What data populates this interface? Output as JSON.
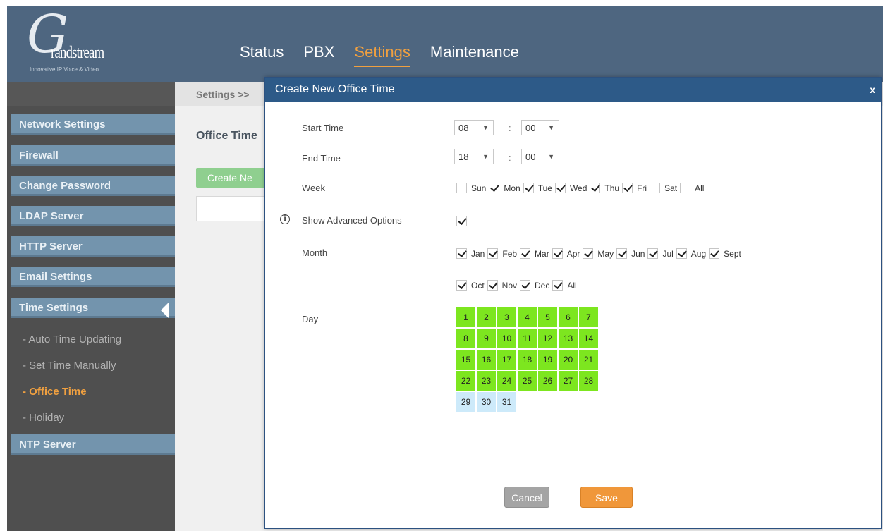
{
  "logo": {
    "word": "randstream",
    "tagline": "Innovative IP Voice & Video"
  },
  "top_nav": [
    {
      "label": "Status",
      "active": false
    },
    {
      "label": "PBX",
      "active": false
    },
    {
      "label": "Settings",
      "active": true
    },
    {
      "label": "Maintenance",
      "active": false
    }
  ],
  "sidebar": {
    "items": [
      {
        "label": "Network Settings"
      },
      {
        "label": "Firewall"
      },
      {
        "label": "Change Password"
      },
      {
        "label": "LDAP Server"
      },
      {
        "label": "HTTP Server"
      },
      {
        "label": "Email Settings"
      },
      {
        "label": "Time Settings"
      },
      {
        "label": "NTP Server"
      }
    ],
    "sub_items": [
      {
        "label": "- Auto Time Updating",
        "active": false
      },
      {
        "label": "- Set Time Manually",
        "active": false
      },
      {
        "label": "- Office Time",
        "active": true
      },
      {
        "label": "- Holiday",
        "active": false
      }
    ]
  },
  "main": {
    "breadcrumb": "Settings >>",
    "page_title": "Office Time",
    "create_button": "Create Ne"
  },
  "modal": {
    "title": "Create New Office Time",
    "close": "x",
    "start_time": {
      "label": "Start Time",
      "hour": "08",
      "minute": "00",
      "sep": ":"
    },
    "end_time": {
      "label": "End Time",
      "hour": "18",
      "minute": "00",
      "sep": ":"
    },
    "week": {
      "label": "Week",
      "days": [
        {
          "label": "Sun",
          "checked": false
        },
        {
          "label": "Mon",
          "checked": true
        },
        {
          "label": "Tue",
          "checked": true
        },
        {
          "label": "Wed",
          "checked": true
        },
        {
          "label": "Thu",
          "checked": true
        },
        {
          "label": "Fri",
          "checked": true
        },
        {
          "label": "Sat",
          "checked": false
        },
        {
          "label": "All",
          "checked": false
        }
      ]
    },
    "advanced": {
      "label": "Show Advanced Options",
      "checked": true
    },
    "month": {
      "label": "Month",
      "row1": [
        {
          "label": "Jan",
          "checked": true
        },
        {
          "label": "Feb",
          "checked": true
        },
        {
          "label": "Mar",
          "checked": true
        },
        {
          "label": "Apr",
          "checked": true
        },
        {
          "label": "May",
          "checked": true
        },
        {
          "label": "Jun",
          "checked": true
        },
        {
          "label": "Jul",
          "checked": true
        },
        {
          "label": "Aug",
          "checked": true
        },
        {
          "label": "Sept",
          "checked": true
        }
      ],
      "row2": [
        {
          "label": "Oct",
          "checked": true
        },
        {
          "label": "Nov",
          "checked": true
        },
        {
          "label": "Dec",
          "checked": true
        },
        {
          "label": "All",
          "checked": true
        }
      ]
    },
    "day": {
      "label": "Day",
      "days": [
        "1",
        "2",
        "3",
        "4",
        "5",
        "6",
        "7",
        "8",
        "9",
        "10",
        "11",
        "12",
        "13",
        "14",
        "15",
        "16",
        "17",
        "18",
        "19",
        "20",
        "21",
        "22",
        "23",
        "24",
        "25",
        "26",
        "27",
        "28",
        "29",
        "30",
        "31"
      ],
      "selected_through": 28
    },
    "cancel": "Cancel",
    "save": "Save"
  },
  "colors": {
    "header": "#4e6680",
    "accent": "#f0a040",
    "modal_header": "#2d5a88",
    "day_selected": "#7de61f",
    "day_unselected": "#cdeafa",
    "save": "#f0973a",
    "cancel": "#a4a4a4"
  }
}
